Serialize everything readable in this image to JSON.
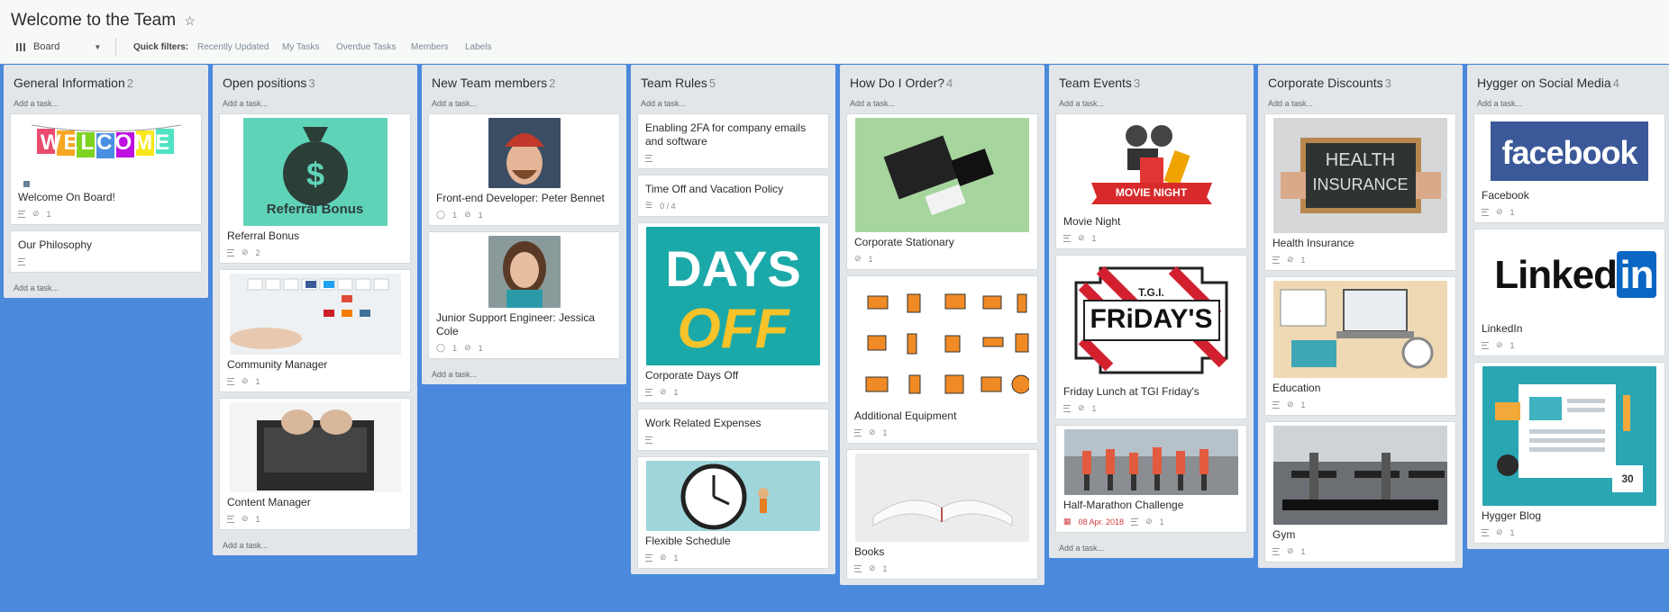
{
  "board": {
    "title": "Welcome to the Team",
    "star": "☆",
    "view_label": "Board",
    "quick_filters_label": "Quick filters:",
    "filters": [
      "Recently Updated",
      "My Tasks",
      "Overdue Tasks",
      "Members",
      "Labels"
    ]
  },
  "add_task_label": "Add a task...",
  "columns": [
    {
      "title": "General Information",
      "count": "2",
      "cards": [
        {
          "title": "Welcome On Board!",
          "attachments": "1",
          "thumb_text": "WELCOME"
        },
        {
          "title": "Our Philosophy"
        }
      ]
    },
    {
      "title": "Open positions",
      "count": "3",
      "cards": [
        {
          "title": "Referral Bonus",
          "attachments": "2",
          "thumb_text": "Referral Bonus"
        },
        {
          "title": "Community Manager",
          "attachments": "1"
        },
        {
          "title": "Content Manager",
          "attachments": "1"
        }
      ]
    },
    {
      "title": "New Team members",
      "count": "2",
      "cards": [
        {
          "title": "Front-end Developer: Peter Bennet",
          "comments": "1",
          "attachments": "1"
        },
        {
          "title": "Junior Support Engineer: Jessica Cole",
          "comments": "1",
          "attachments": "1"
        }
      ]
    },
    {
      "title": "Team Rules",
      "count": "5",
      "cards": [
        {
          "title": "Enabling 2FA for company emails and software"
        },
        {
          "title": "Time Off and Vacation Policy",
          "checklist": "0 / 4"
        },
        {
          "title": "Corporate Days Off",
          "attachments": "1",
          "thumb_text_1": "DAYS",
          "thumb_text_2": "OFF"
        },
        {
          "title": "Work Related Expenses"
        },
        {
          "title": "Flexible Schedule",
          "attachments": "1"
        }
      ]
    },
    {
      "title": "How Do I Order?",
      "count": "4",
      "cards": [
        {
          "title": "Corporate Stationary",
          "attachments": "1"
        },
        {
          "title": "Additional Equipment",
          "attachments": "1"
        },
        {
          "title": "Books",
          "attachments": "1"
        }
      ]
    },
    {
      "title": "Team Events",
      "count": "3",
      "cards": [
        {
          "title": "Movie Night",
          "attachments": "1",
          "thumb_text": "MOVIE NIGHT"
        },
        {
          "title": "Friday Lunch at TGI Friday's",
          "attachments": "1",
          "thumb_text": "FRiDAY'S",
          "thumb_small": "T.G.I."
        },
        {
          "title": "Half-Marathon Challenge",
          "date": "08 Apr. 2018",
          "attachments": "1"
        }
      ]
    },
    {
      "title": "Corporate Discounts",
      "count": "3",
      "cards": [
        {
          "title": "Health Insurance",
          "attachments": "1",
          "thumb_text_1": "HEALTH",
          "thumb_text_2": "INSURANCE"
        },
        {
          "title": "Education",
          "attachments": "1"
        },
        {
          "title": "Gym",
          "attachments": "1"
        }
      ]
    },
    {
      "title": "Hygger on Social Media",
      "count": "4",
      "cards": [
        {
          "title": "Facebook",
          "attachments": "1",
          "thumb_text": "facebook"
        },
        {
          "title": "LinkedIn",
          "attachments": "1",
          "thumb_text_1": "Linked",
          "thumb_text_2": "in"
        },
        {
          "title": "Hygger Blog",
          "attachments": "1",
          "thumb_text": "30"
        }
      ]
    }
  ],
  "colors": {
    "background": "#4a89dc",
    "column": "#e2e6e9",
    "card": "#ffffff",
    "date_red": "#d23c3c"
  }
}
